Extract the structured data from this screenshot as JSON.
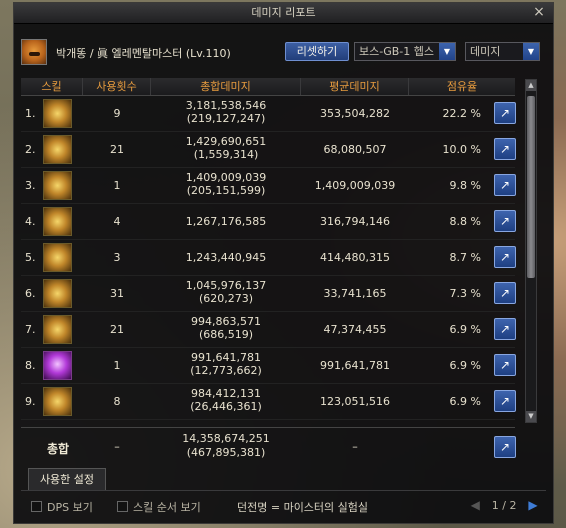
{
  "window": {
    "title": "데미지 리포트",
    "close_icon": "×"
  },
  "header": {
    "character_name": "박개똥 / 眞 엘레멘탈마스터 (Lv.110)",
    "reset_label": "리셋하기",
    "boss_select": "보스-GB-1 헵스",
    "metric_select": "데미지"
  },
  "table": {
    "columns": [
      "스킬",
      "사용횟수",
      "총합데미지",
      "평균데미지",
      "점유율"
    ],
    "rows": [
      {
        "idx": "1.",
        "count": "9",
        "total": "3,181,538,546",
        "total_sub": "(219,127,247)",
        "avg": "353,504,282",
        "share": "22.2 %"
      },
      {
        "idx": "2.",
        "count": "21",
        "total": "1,429,690,651",
        "total_sub": "(1,559,314)",
        "avg": "68,080,507",
        "share": "10.0 %"
      },
      {
        "idx": "3.",
        "count": "1",
        "total": "1,409,009,039",
        "total_sub": "(205,151,599)",
        "avg": "1,409,009,039",
        "share": "9.8 %"
      },
      {
        "idx": "4.",
        "count": "4",
        "total": "1,267,176,585",
        "total_sub": "",
        "avg": "316,794,146",
        "share": "8.8 %"
      },
      {
        "idx": "5.",
        "count": "3",
        "total": "1,243,440,945",
        "total_sub": "",
        "avg": "414,480,315",
        "share": "8.7 %"
      },
      {
        "idx": "6.",
        "count": "31",
        "total": "1,045,976,137",
        "total_sub": "(620,273)",
        "avg": "33,741,165",
        "share": "7.3 %"
      },
      {
        "idx": "7.",
        "count": "21",
        "total": "994,863,571",
        "total_sub": "(686,519)",
        "avg": "47,374,455",
        "share": "6.9 %"
      },
      {
        "idx": "8.",
        "count": "1",
        "total": "991,641,781",
        "total_sub": "(12,773,662)",
        "avg": "991,641,781",
        "share": "6.9 %"
      },
      {
        "idx": "9.",
        "count": "8",
        "total": "984,412,131",
        "total_sub": "(26,446,361)",
        "avg": "123,051,516",
        "share": "6.9 %"
      }
    ],
    "summary": {
      "label": "총합",
      "count": "–",
      "total": "14,358,674,251",
      "total_sub": "(467,895,381)",
      "avg": "–"
    }
  },
  "tabs": {
    "settings": "사용한 설정"
  },
  "footer": {
    "dps_label": "DPS 보기",
    "skill_order_label": "스킬 순서 보기",
    "dungeon": "던전명 = 마이스터의 실험실",
    "page": "1 / 2"
  }
}
